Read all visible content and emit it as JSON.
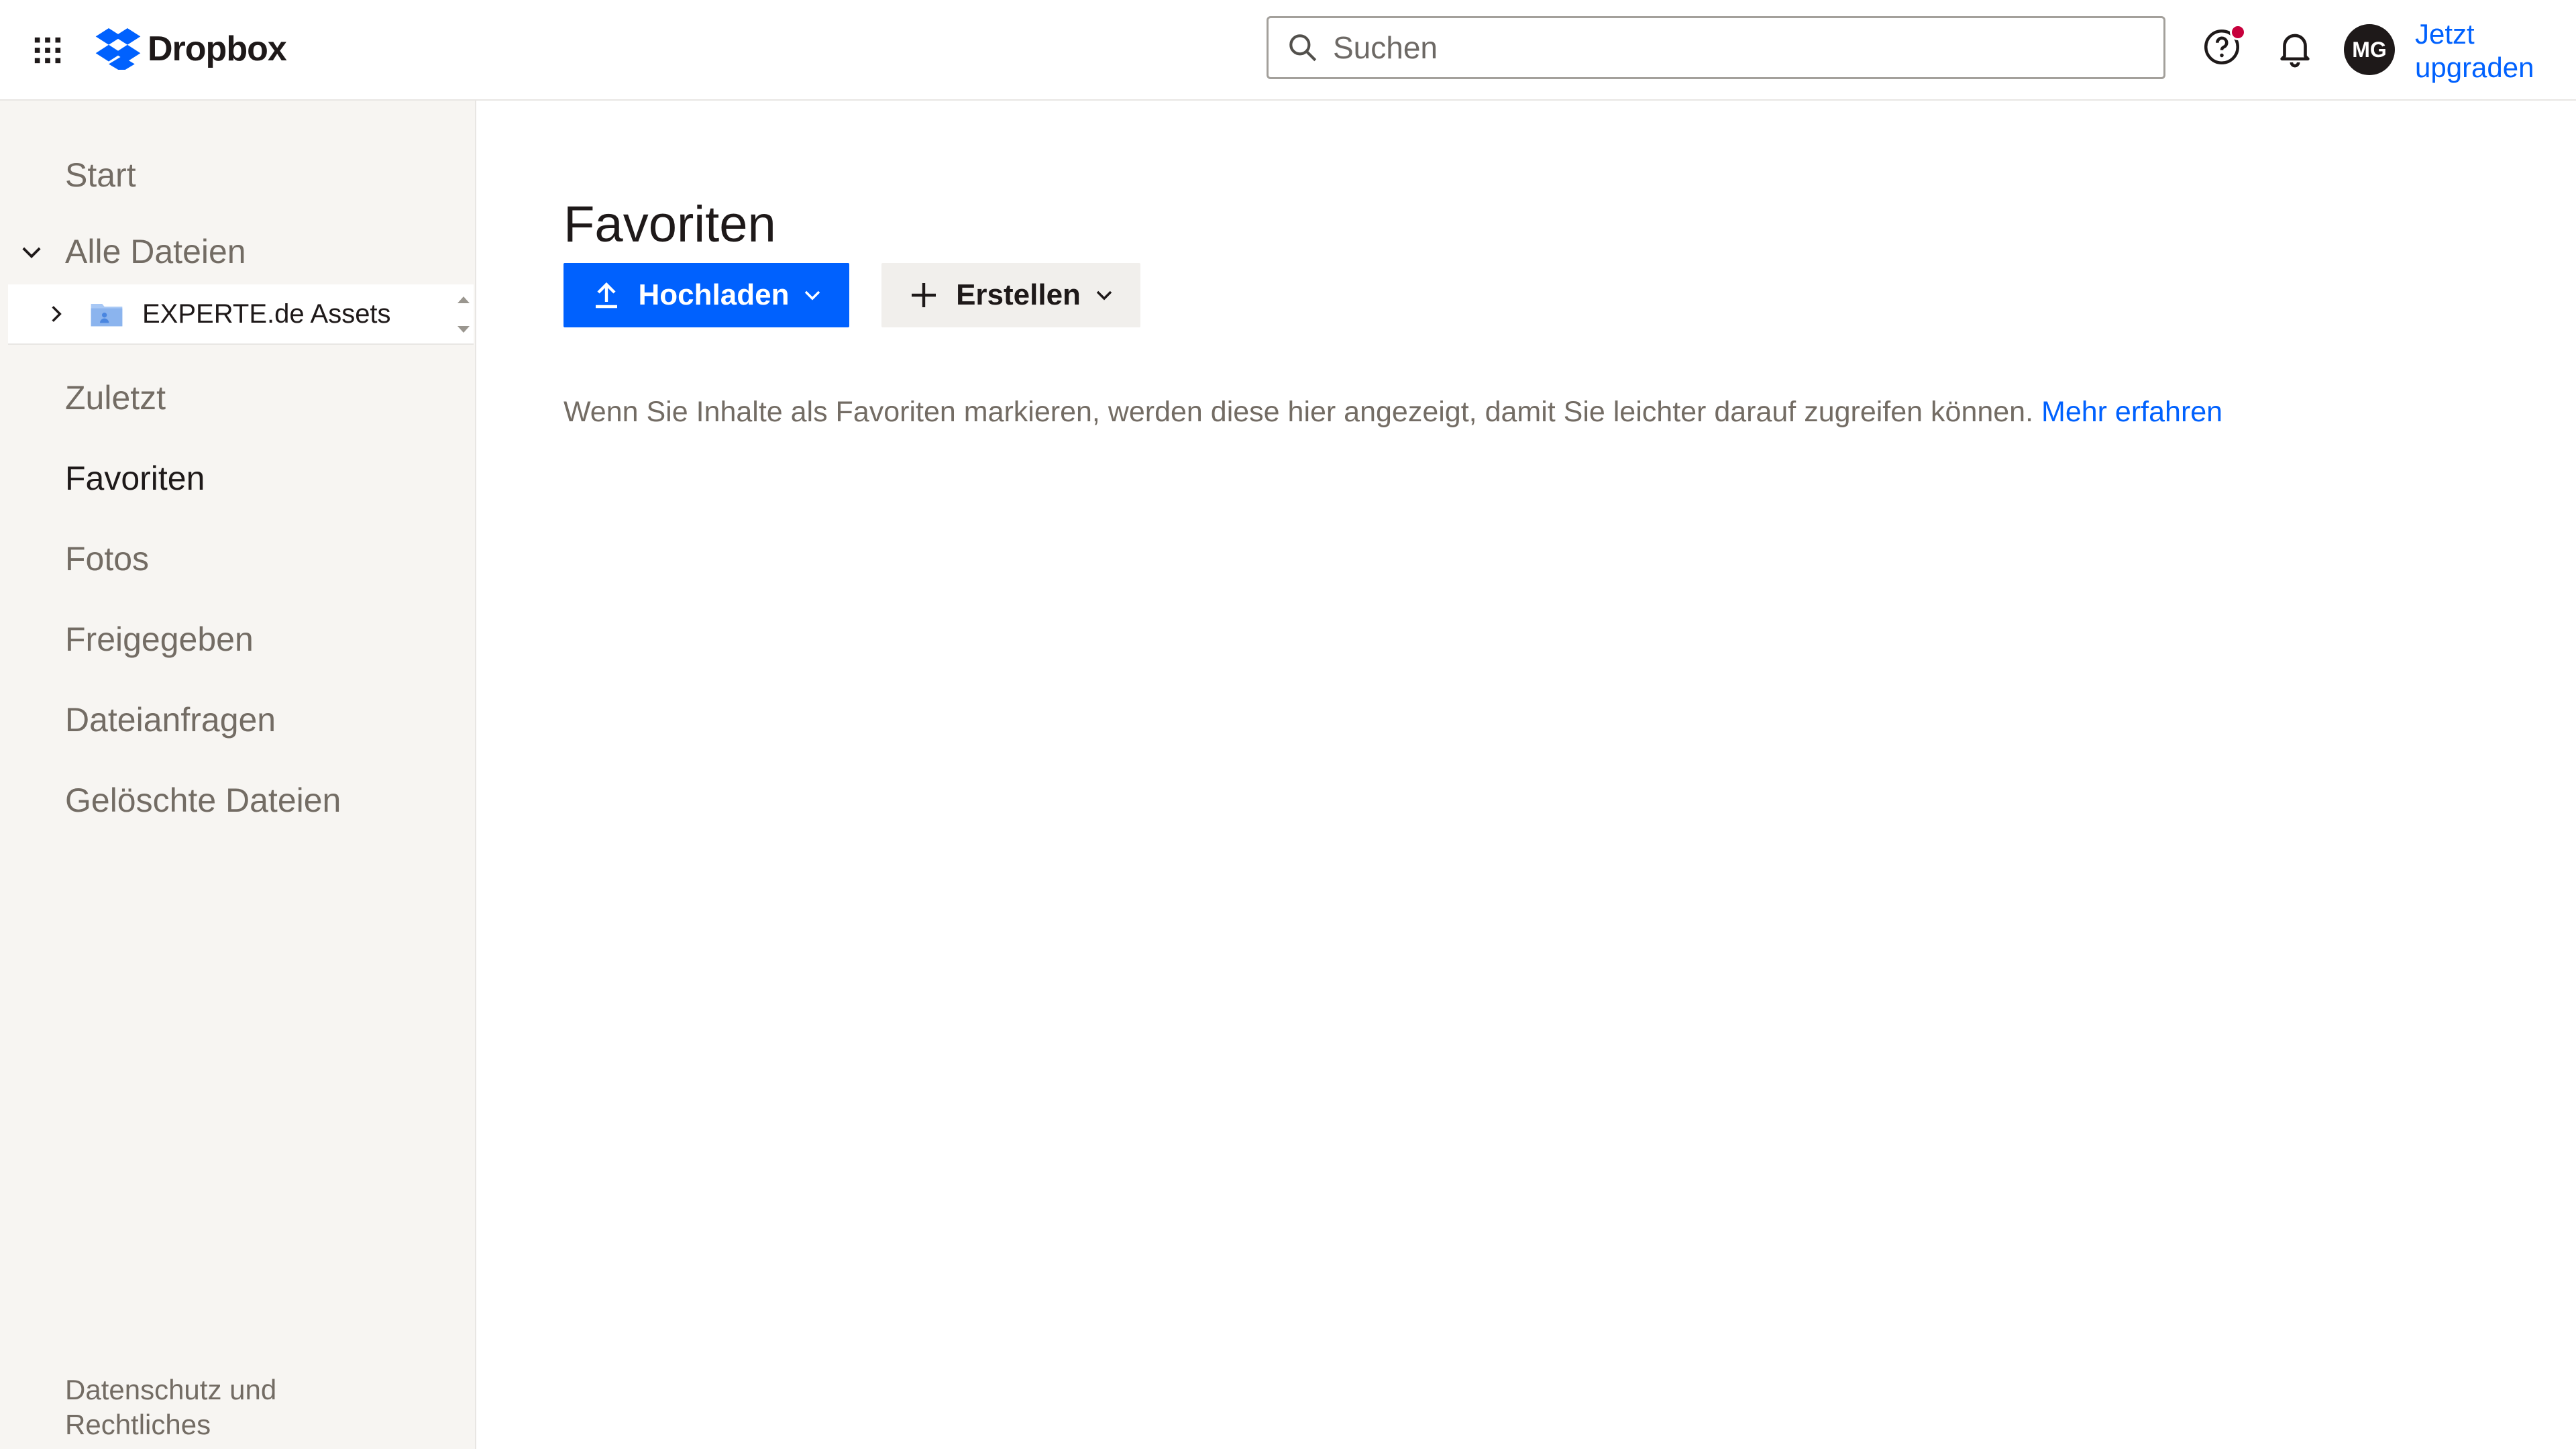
{
  "header": {
    "app_name": "Dropbox",
    "search_placeholder": "Suchen",
    "avatar_initials": "MG",
    "upgrade_label": "Jetzt upgraden",
    "brand_color": "#0061fe"
  },
  "sidebar": {
    "items": [
      {
        "label": "Start"
      },
      {
        "label": "Alle Dateien"
      },
      {
        "label": "Zuletzt"
      },
      {
        "label": "Favoriten",
        "active": true
      },
      {
        "label": "Fotos"
      },
      {
        "label": "Freigegeben"
      },
      {
        "label": "Dateianfragen"
      },
      {
        "label": "Gelöschte Dateien"
      }
    ],
    "tree": {
      "folder_label": "EXPERTE.de Assets"
    },
    "footer_label": "Datenschutz und Rechtliches"
  },
  "main": {
    "title": "Favoriten",
    "upload_label": "Hochladen",
    "create_label": "Erstellen",
    "empty_message": "Wenn Sie Inhalte als Favoriten markieren, werden diese hier angezeigt, damit Sie leichter darauf zugreifen können.",
    "learn_more_label": "Mehr erfahren"
  },
  "icons": {
    "apps": "grid-icon",
    "search": "search-icon",
    "help": "help-icon",
    "notifications": "bell-icon",
    "upload": "upload-icon",
    "create": "plus-icon"
  }
}
